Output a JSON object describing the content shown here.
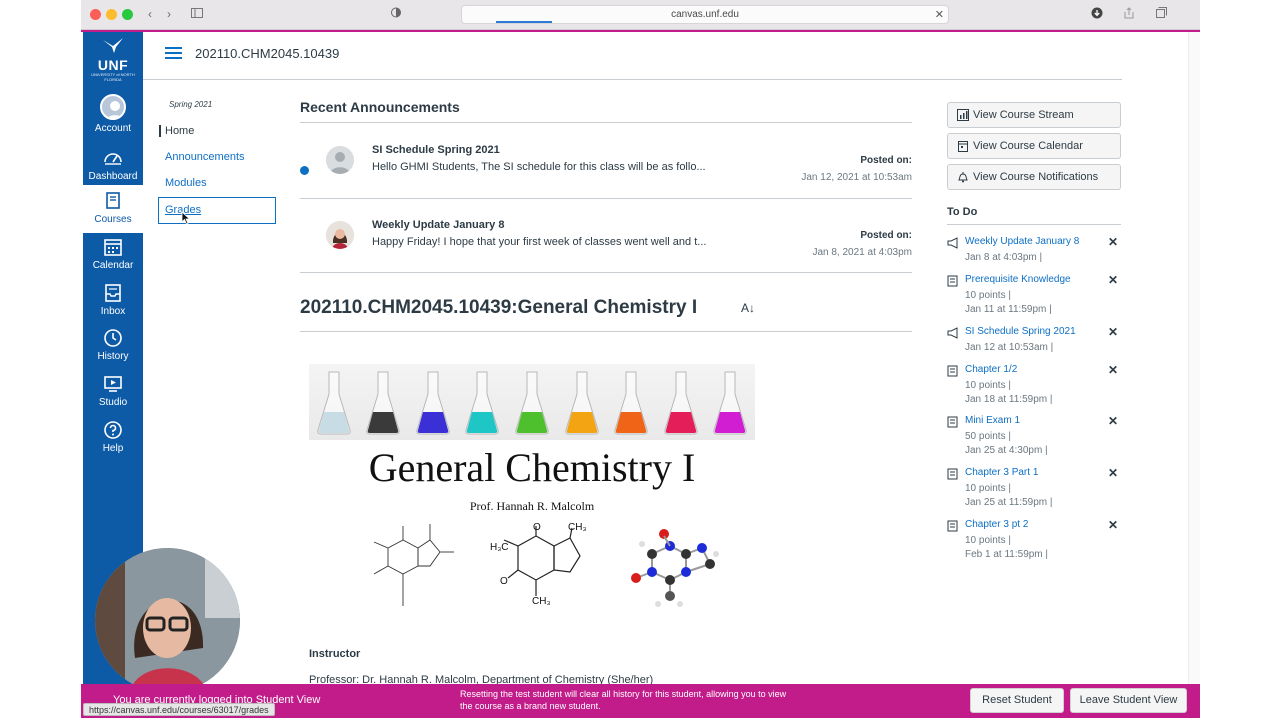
{
  "browser": {
    "url": "canvas.unf.edu",
    "status_url": "https://canvas.unf.edu/courses/63017/grades"
  },
  "global_nav": {
    "logo": {
      "text": "UNF",
      "sub": "UNIVERSITY of NORTH FLORIDA"
    },
    "items": [
      {
        "label": "Account",
        "icon": "user-avatar-icon"
      },
      {
        "label": "Dashboard",
        "icon": "dashboard-icon"
      },
      {
        "label": "Courses",
        "icon": "book-icon",
        "active": true
      },
      {
        "label": "Calendar",
        "icon": "calendar-icon"
      },
      {
        "label": "Inbox",
        "icon": "inbox-icon"
      },
      {
        "label": "History",
        "icon": "clock-icon"
      },
      {
        "label": "Studio",
        "icon": "studio-icon"
      },
      {
        "label": "Help",
        "icon": "help-icon"
      }
    ]
  },
  "header": {
    "course_code": "202110.CHM2045.10439"
  },
  "course_nav": {
    "term": "Spring 2021",
    "items": [
      "Home",
      "Announcements",
      "Modules",
      "Grades"
    ]
  },
  "announcements": {
    "heading": "Recent Announcements",
    "items": [
      {
        "title": "SI Schedule Spring 2021",
        "body": "Hello GHMI Students,  The SI schedule for this class will be as follo...",
        "posted_label": "Posted on:",
        "date": "Jan 12, 2021 at 10:53am",
        "unread": true
      },
      {
        "title": "Weekly Update January 8",
        "body": "Happy Friday! I hope that your first week of classes went well and t...",
        "posted_label": "Posted on:",
        "date": "Jan 8, 2021 at 4:03pm",
        "unread": false
      }
    ]
  },
  "course_page": {
    "heading": "202110.CHM2045.10439:General Chemistry I",
    "banner_title": "General Chemistry I",
    "professor": "Prof. Hannah R. Malcolm",
    "instructor_heading": "Instructor",
    "instructor_line": "Professor: Dr. Hannah R. Malcolm, Department of Chemistry (She/her)",
    "flask_colors": [
      "#c8dce6",
      "#3a3a3a",
      "#3b2fd6",
      "#1fc6c6",
      "#4ec02e",
      "#f2a413",
      "#f06418",
      "#e41e58",
      "#d21ed2"
    ]
  },
  "sidebar_buttons": [
    {
      "label": "View Course Stream",
      "icon": "stream-icon"
    },
    {
      "label": "View Course Calendar",
      "icon": "calendar-icon"
    },
    {
      "label": "View Course Notifications",
      "icon": "bell-icon"
    }
  ],
  "todo": {
    "heading": "To Do",
    "items": [
      {
        "title": "Weekly Update January 8",
        "line2": "Jan 8 at 4:03pm  |",
        "line3": "",
        "icon": "megaphone-icon"
      },
      {
        "title": "Prerequisite Knowledge",
        "line2": "10 points  |",
        "line3": "Jan 11 at 11:59pm  |",
        "icon": "assignment-icon"
      },
      {
        "title": "SI Schedule Spring 2021",
        "line2": "Jan 12 at 10:53am  |",
        "line3": "",
        "icon": "megaphone-icon"
      },
      {
        "title": "Chapter 1/2",
        "line2": "10 points  |",
        "line3": "Jan 18 at 11:59pm  |",
        "icon": "assignment-icon"
      },
      {
        "title": "Mini Exam 1",
        "line2": "50 points  |",
        "line3": "Jan 25 at 4:30pm  |",
        "icon": "assignment-icon"
      },
      {
        "title": "Chapter 3 Part 1",
        "line2": "10 points  |",
        "line3": "Jan 25 at 11:59pm  |",
        "icon": "assignment-icon"
      },
      {
        "title": "Chapter 3 pt 2",
        "line2": "10 points  |",
        "line3": "Feb 1 at 11:59pm  |",
        "icon": "assignment-icon"
      }
    ]
  },
  "student_view": {
    "status": "You are currently logged into Student View",
    "notice_line1": "Resetting the test student will clear all history for this student, allowing you to view",
    "notice_line2": "the course as a brand new student.",
    "reset_label": "Reset Student",
    "leave_label": "Leave Student View"
  },
  "colors": {
    "nav_blue": "#0d5aa6",
    "link_blue": "#0d6fc4",
    "student_view_magenta": "#c21c8a"
  }
}
